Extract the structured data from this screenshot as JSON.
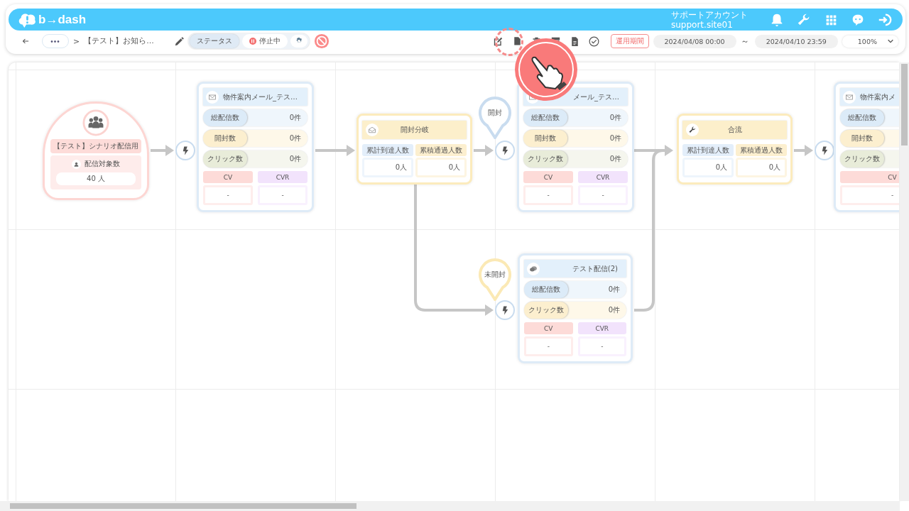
{
  "header": {
    "logo": "b→dash",
    "account_name": "サポートアカウント",
    "account_id": "support.site01"
  },
  "toolbar": {
    "more": "•••",
    "separator": ">",
    "breadcrumb": "【テスト】お知ら…",
    "status_label": "ステータス",
    "status": {
      "text": "停止中",
      "paused": true
    },
    "period_button": "運用期間",
    "start_date": "2024/04/08 00:00",
    "range_sep": "～",
    "end_date": "2024/04/10 23:59",
    "zoom": "100%"
  },
  "nodes": [
    {
      "kind": "start",
      "title": "【テスト】シナリオ配信用",
      "count_label": "配信対象数",
      "count": "40 人"
    },
    {
      "kind": "mail",
      "title": "物件案内メール_テス…",
      "stats": [
        {
          "label": "総配信数",
          "value": "0件",
          "color": "#dcebf8"
        },
        {
          "label": "開封数",
          "value": "0件",
          "color": "#fcefcf"
        },
        {
          "label": "クリック数",
          "value": "0件",
          "color": "#e8ecd9"
        }
      ],
      "metrics": [
        {
          "label": "CV",
          "value": "-",
          "color": "#fddbd8"
        },
        {
          "label": "CVR",
          "value": "-",
          "color": "#f2e3fc"
        }
      ]
    },
    {
      "kind": "branch",
      "title": "開封分岐",
      "columns": [
        {
          "label": "累計到達人数",
          "value": "0人",
          "color": "#e3eefa"
        },
        {
          "label": "累積通過人数",
          "value": "0人",
          "color": "#fcefcf"
        }
      ]
    },
    {
      "kind": "mail",
      "title": "メール_テス…",
      "stats": [
        {
          "label": "総配信数",
          "value": "0件",
          "color": "#dcebf8"
        },
        {
          "label": "開封数",
          "value": "0件",
          "color": "#fcefcf"
        },
        {
          "label": "クリック数",
          "value": "0件",
          "color": "#e8ecd9"
        }
      ],
      "metrics": [
        {
          "label": "CV",
          "value": "-",
          "color": "#fddbd8"
        },
        {
          "label": "CVR",
          "value": "-",
          "color": "#f2e3fc"
        }
      ]
    },
    {
      "kind": "chat",
      "title": "テスト配信(2)",
      "stats": [
        {
          "label": "総配信数",
          "value": "0件",
          "color": "#dcebf8"
        },
        {
          "label": "クリック数",
          "value": "0件",
          "color": "#fcefcf"
        }
      ],
      "metrics": [
        {
          "label": "CV",
          "value": "-",
          "color": "#fddbd8"
        },
        {
          "label": "CVR",
          "value": "-",
          "color": "#f2e3fc"
        }
      ]
    },
    {
      "kind": "merge",
      "title": "合流",
      "columns": [
        {
          "label": "累計到達人数",
          "value": "0人",
          "color": "#e3eefa"
        },
        {
          "label": "累積通過人数",
          "value": "0人",
          "color": "#fcefcf"
        }
      ]
    },
    {
      "kind": "mail",
      "title": "物件案内メ",
      "stats": [
        {
          "label": "総配信数",
          "color": "#dcebf8"
        },
        {
          "label": "開封数",
          "color": "#fcefcf"
        },
        {
          "label": "クリック数",
          "color": "#e8ecd9"
        }
      ],
      "metrics": [
        {
          "label": "CV",
          "value": "-",
          "color": "#fddbd8"
        }
      ]
    }
  ],
  "pins": [
    {
      "label": "開封",
      "color": "#c9dcef"
    },
    {
      "label": "未開封",
      "color": "#fbe9b5"
    }
  ]
}
